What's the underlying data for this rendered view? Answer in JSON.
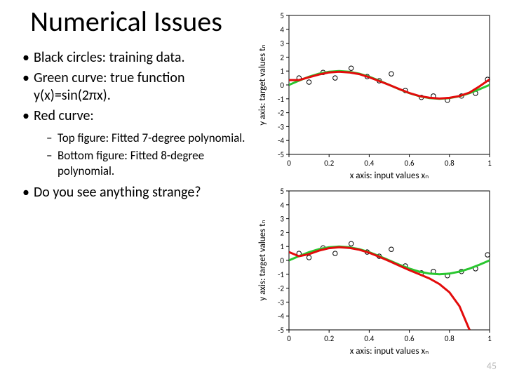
{
  "title": "Numerical Issues",
  "bullets": {
    "b1": "Black circles: training data.",
    "b2": "Green curve: true function y(x)=sin(2πx).",
    "b3": "Red curve:",
    "s1": "Top figure: Fitted 7-degree polynomial.",
    "s2": "Bottom figure: Fitted 8-degree polynomial.",
    "b4": "Do you see anything strange?"
  },
  "common_axis": {
    "xlabel": "x axis: input values xₙ",
    "ylabel": "y axis: target values tₙ",
    "xticks": [
      "0",
      "0.2",
      "0.4",
      "0.6",
      "0.8",
      "1"
    ],
    "yticks": [
      "-5",
      "-4",
      "-3",
      "-2",
      "-1",
      "0",
      "1",
      "2",
      "3",
      "4",
      "5"
    ]
  },
  "chart_data": [
    {
      "type": "line",
      "title": "",
      "xlabel": "x axis: input values xₙ",
      "ylabel": "y axis: target values tₙ",
      "xlim": [
        0,
        1
      ],
      "ylim": [
        -5,
        5
      ],
      "series": [
        {
          "name": "training-data",
          "style": "circles-black",
          "x": [
            0.05,
            0.1,
            0.17,
            0.23,
            0.31,
            0.39,
            0.45,
            0.51,
            0.58,
            0.66,
            0.72,
            0.79,
            0.86,
            0.93,
            0.99
          ],
          "values": [
            0.5,
            0.2,
            0.9,
            0.5,
            1.2,
            0.6,
            0.3,
            0.8,
            -0.4,
            -0.9,
            -0.8,
            -1.1,
            -0.8,
            -0.6,
            0.4
          ]
        },
        {
          "name": "true-sin2pix",
          "style": "line-green",
          "x": [
            0.0,
            0.05,
            0.1,
            0.15,
            0.2,
            0.25,
            0.3,
            0.35,
            0.4,
            0.45,
            0.5,
            0.55,
            0.6,
            0.65,
            0.7,
            0.75,
            0.8,
            0.85,
            0.9,
            0.95,
            1.0
          ],
          "values": [
            0.0,
            0.31,
            0.59,
            0.81,
            0.95,
            1.0,
            0.95,
            0.81,
            0.59,
            0.31,
            0.0,
            -0.31,
            -0.59,
            -0.81,
            -0.95,
            -1.0,
            -0.95,
            -0.81,
            -0.59,
            -0.31,
            0.0
          ]
        },
        {
          "name": "fitted-poly-degree-7",
          "style": "line-red",
          "x": [
            0.0,
            0.05,
            0.1,
            0.15,
            0.2,
            0.25,
            0.3,
            0.35,
            0.4,
            0.45,
            0.5,
            0.55,
            0.6,
            0.65,
            0.7,
            0.75,
            0.8,
            0.85,
            0.9,
            0.95,
            1.0
          ],
          "values": [
            0.35,
            0.35,
            0.55,
            0.75,
            0.9,
            0.95,
            0.9,
            0.78,
            0.55,
            0.28,
            0.0,
            -0.3,
            -0.58,
            -0.8,
            -0.92,
            -0.98,
            -0.93,
            -0.8,
            -0.55,
            -0.1,
            0.4
          ]
        }
      ]
    },
    {
      "type": "line",
      "title": "",
      "xlabel": "x axis: input values xₙ",
      "ylabel": "y axis: target values tₙ",
      "xlim": [
        0,
        1
      ],
      "ylim": [
        -5,
        5
      ],
      "series": [
        {
          "name": "training-data",
          "style": "circles-black",
          "x": [
            0.05,
            0.1,
            0.17,
            0.23,
            0.31,
            0.39,
            0.45,
            0.51,
            0.58,
            0.66,
            0.72,
            0.79,
            0.86,
            0.93,
            0.99
          ],
          "values": [
            0.5,
            0.2,
            0.9,
            0.5,
            1.2,
            0.6,
            0.3,
            0.8,
            -0.4,
            -0.9,
            -0.8,
            -1.1,
            -0.8,
            -0.6,
            0.4
          ]
        },
        {
          "name": "true-sin2pix",
          "style": "line-green",
          "x": [
            0.0,
            0.05,
            0.1,
            0.15,
            0.2,
            0.25,
            0.3,
            0.35,
            0.4,
            0.45,
            0.5,
            0.55,
            0.6,
            0.65,
            0.7,
            0.75,
            0.8,
            0.85,
            0.9,
            0.95,
            1.0
          ],
          "values": [
            0.0,
            0.31,
            0.59,
            0.81,
            0.95,
            1.0,
            0.95,
            0.81,
            0.59,
            0.31,
            0.0,
            -0.31,
            -0.59,
            -0.81,
            -0.95,
            -1.0,
            -0.95,
            -0.81,
            -0.59,
            -0.31,
            0.0
          ]
        },
        {
          "name": "fitted-poly-degree-8",
          "style": "line-red",
          "x": [
            0.0,
            0.05,
            0.1,
            0.15,
            0.2,
            0.25,
            0.3,
            0.35,
            0.4,
            0.45,
            0.5,
            0.55,
            0.6,
            0.65,
            0.7,
            0.75,
            0.8,
            0.85,
            0.9
          ],
          "values": [
            0.6,
            0.3,
            0.45,
            0.7,
            0.88,
            0.95,
            0.9,
            0.77,
            0.55,
            0.26,
            -0.05,
            -0.38,
            -0.7,
            -1.0,
            -1.3,
            -1.7,
            -2.3,
            -3.3,
            -5.0
          ]
        }
      ]
    }
  ],
  "page_number": "45"
}
